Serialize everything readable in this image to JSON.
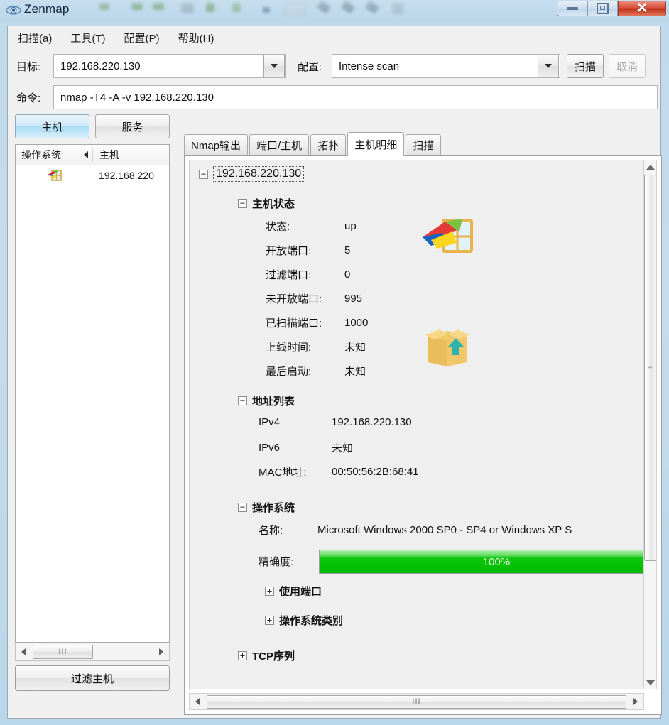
{
  "window": {
    "title": "Zenmap",
    "app_icon": "eye-icon",
    "controls": {
      "minimize": "minimize-icon",
      "maximize": "maximize-icon",
      "close": "close-icon",
      "close_glyph": "✕"
    }
  },
  "menubar": {
    "items": [
      {
        "label": "扫描",
        "accel": "a"
      },
      {
        "label": "工具",
        "accel": "T"
      },
      {
        "label": "配置",
        "accel": "P"
      },
      {
        "label": "帮助",
        "accel": "H"
      }
    ]
  },
  "toolbar": {
    "target_label": "目标:",
    "target_value": "192.168.220.130",
    "profile_label": "配置:",
    "profile_value": "Intense scan",
    "scan_button": "扫描",
    "cancel_button": "取消",
    "command_label": "命令:",
    "command_value": "nmap -T4 -A -v 192.168.220.130"
  },
  "left_pane": {
    "hosts_button": "主机",
    "services_button": "服务",
    "columns": {
      "os": "操作系统",
      "host": "主机"
    },
    "rows": [
      {
        "os_icon": "windows-icon",
        "host": "192.168.220"
      }
    ],
    "filter_button": "过滤主机",
    "scroll_thumb_glyph": "III"
  },
  "tabs": [
    {
      "label": "Nmap输出",
      "active": false
    },
    {
      "label": "端口/主机",
      "active": false
    },
    {
      "label": "拓扑",
      "active": false
    },
    {
      "label": "主机明细",
      "active": true
    },
    {
      "label": "扫描",
      "active": false
    }
  ],
  "details": {
    "root": {
      "label": "192.168.220.130",
      "toggle": "−"
    },
    "sections": [
      {
        "toggle": "−",
        "title": "主机状态",
        "fields": [
          {
            "key": "状态:",
            "value": "up"
          },
          {
            "key": "开放端口:",
            "value": "5"
          },
          {
            "key": "过滤端口:",
            "value": "0"
          },
          {
            "key": "未开放端口:",
            "value": "995"
          },
          {
            "key": "已扫描端口:",
            "value": "1000"
          },
          {
            "key": "上线时间:",
            "value": "未知"
          },
          {
            "key": "最后启动:",
            "value": "未知"
          }
        ]
      },
      {
        "toggle": "−",
        "title": "地址列表",
        "fields": [
          {
            "key": "IPv4",
            "value": "192.168.220.130"
          },
          {
            "key": "IPv6",
            "value": "未知"
          },
          {
            "key": "MAC地址:",
            "value": "00:50:56:2B:68:41"
          }
        ]
      },
      {
        "toggle": "−",
        "title": "操作系统",
        "fields": [
          {
            "key": "名称:",
            "value": "Microsoft Windows 2000 SP0 - SP4 or Windows XP S"
          },
          {
            "key": "精确度:",
            "value": "100%"
          }
        ]
      }
    ],
    "accuracy": {
      "label": "精确度:",
      "percent_text": "100%",
      "percent": 100,
      "bar_color": "#00bb00"
    },
    "subnodes": [
      {
        "toggle": "+",
        "title": "使用端口"
      },
      {
        "toggle": "+",
        "title": "操作系统类别"
      }
    ],
    "top_nodes": [
      {
        "toggle": "+",
        "title": "TCP序列"
      }
    ],
    "icons": {
      "windows": "windows-logo-icon",
      "box": "box-upload-icon"
    },
    "scroll_thumb_glyph": "III"
  }
}
